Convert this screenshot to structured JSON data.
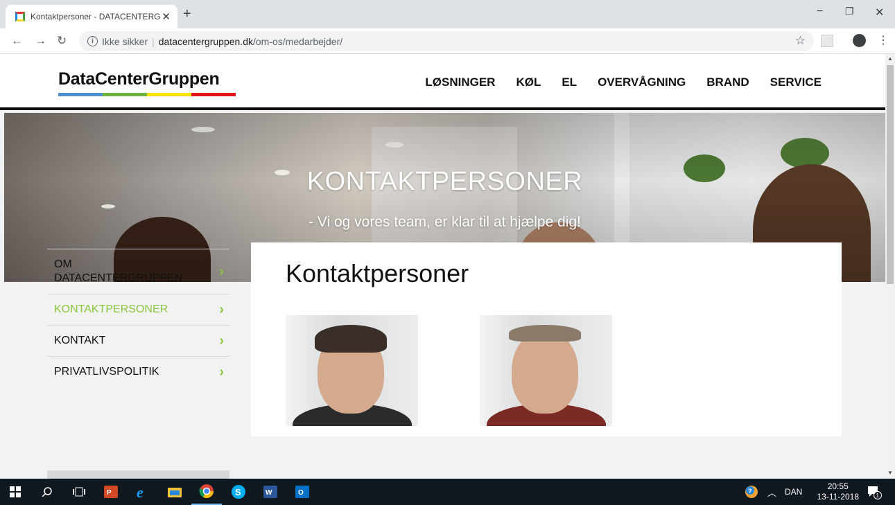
{
  "browser": {
    "tab_title": "Kontaktpersoner - DATACENTERG",
    "security_label": "Ikke sikker",
    "url_host": "datacentergruppen.dk",
    "url_path": "/om-os/medarbejder/"
  },
  "site": {
    "logo_text": "DataCenterGruppen",
    "logo_colors": [
      "#4e8fd0",
      "#6db33f",
      "#f5e400",
      "#e3141b"
    ],
    "nav": [
      "LØSNINGER",
      "KØL",
      "EL",
      "OVERVÅGNING",
      "BRAND",
      "SERVICE"
    ]
  },
  "hero": {
    "title": "KONTAKTPERSONER",
    "subtitle": "- Vi og vores team, er klar til at hjælpe dig!"
  },
  "sidebar": {
    "items": [
      {
        "label": "OM DATACENTERGRUPPEN",
        "active": false
      },
      {
        "label": "KONTAKTPERSONER",
        "active": true
      },
      {
        "label": "KONTAKT",
        "active": false
      },
      {
        "label": "PRIVATLIVSPOLITIK",
        "active": false
      }
    ]
  },
  "content": {
    "heading": "Kontaktpersoner"
  },
  "colors": {
    "accent_green": "#8cc63f",
    "taskbar": "#101820"
  },
  "taskbar": {
    "language": "DAN",
    "time": "20:55",
    "date": "13-11-2018",
    "notification_count": "1"
  }
}
